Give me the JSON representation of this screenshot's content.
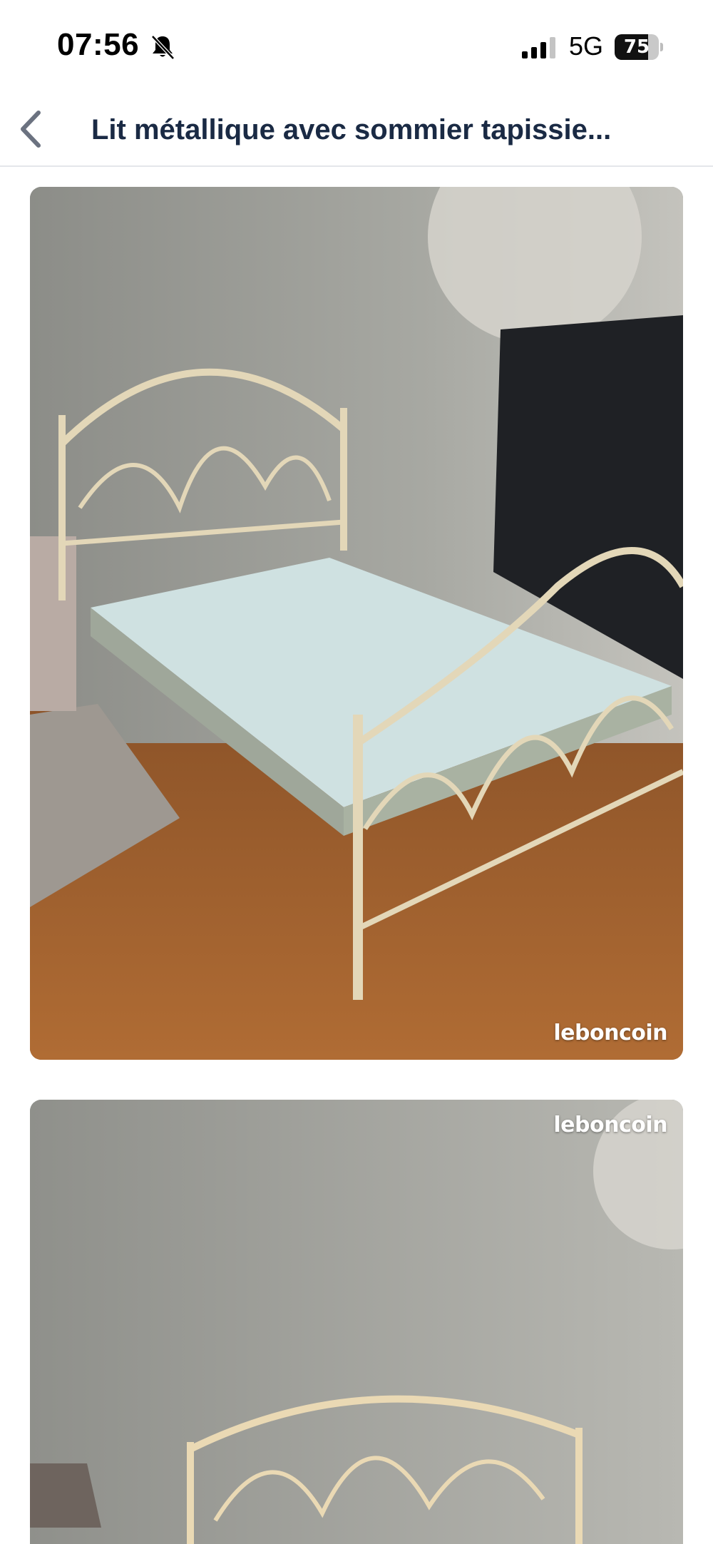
{
  "status_bar": {
    "time": "07:56",
    "network": "5G",
    "battery_percent": "75",
    "battery_level": 0.75,
    "icons": [
      "bell-slash-icon",
      "signal-bars-icon",
      "battery-icon"
    ]
  },
  "header": {
    "back_icon": "chevron-left-icon",
    "title": "Lit métallique avec sommier tapissie..."
  },
  "gallery": {
    "photos": [
      {
        "watermark": "leboncoin"
      },
      {
        "watermark": "leboncoin"
      }
    ]
  },
  "colors": {
    "title": "#1a2a44",
    "back_chevron": "#6b7280",
    "divider": "#e4e6ea"
  }
}
